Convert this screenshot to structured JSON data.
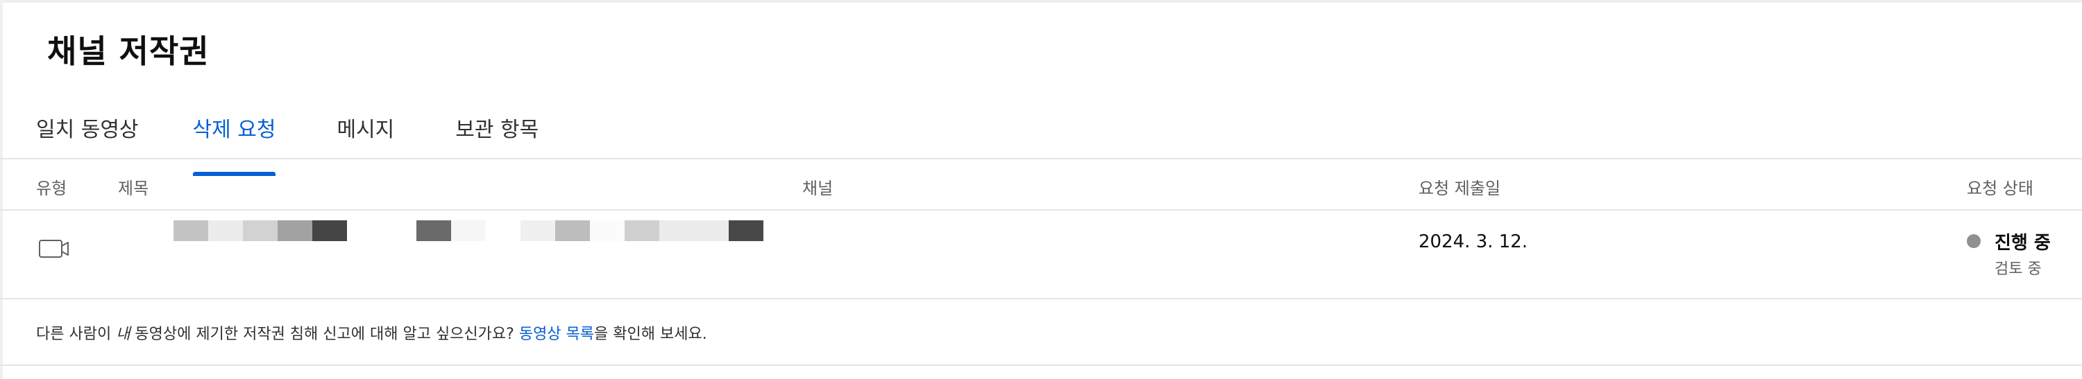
{
  "header": {
    "title": "채널 저작권"
  },
  "tabs": [
    {
      "label": "일치 동영상",
      "active": false
    },
    {
      "label": "삭제 요청",
      "active": true
    },
    {
      "label": "메시지",
      "active": false
    },
    {
      "label": "보관 항목",
      "active": false
    }
  ],
  "table": {
    "columns": {
      "type": "유형",
      "title": "제목",
      "channel": "채널",
      "date": "요청 제출일",
      "status": "요청 상태"
    },
    "rows": [
      {
        "type_icon": "video-icon",
        "title_redacted": true,
        "date": "2024. 3. 12.",
        "status": "진행 중",
        "status_detail": "검토 중",
        "status_color": "#909090"
      }
    ]
  },
  "notice": {
    "prefix": "다른 사람이 ",
    "emphasis": "내",
    "middle": " 동영상에 제기한 저작권 침해 신고에 대해 알고 싶으신가요? ",
    "link": "동영상 목록",
    "suffix": "을 확인해 보세요."
  },
  "colors": {
    "accent": "#065fd4",
    "divider": "#e5e5e5",
    "muted_text": "#606060"
  }
}
